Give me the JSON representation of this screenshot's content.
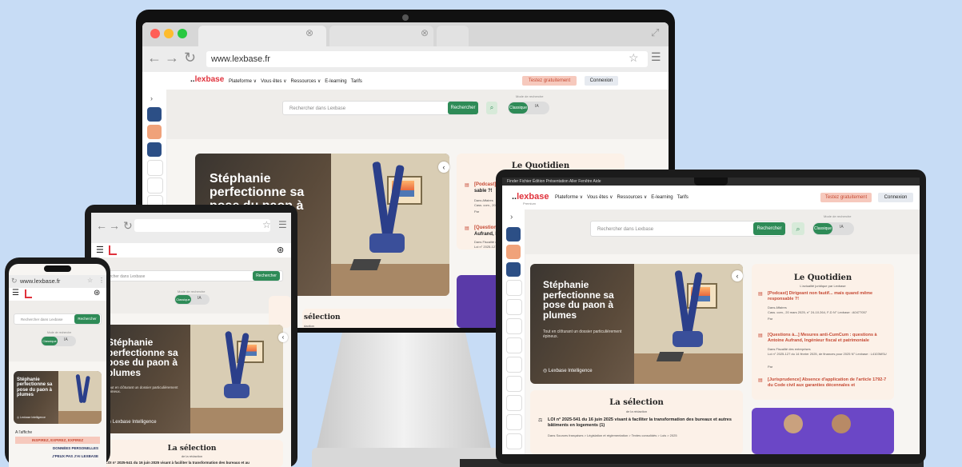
{
  "url": "www.lexbase.fr",
  "logo": {
    "prefix": "..",
    "name": "lexbase",
    "tagline": "Premium"
  },
  "nav": [
    "Plateforme ∨",
    "Vous êtes ∨",
    "Ressources ∨",
    "E-learning",
    "Tarifs"
  ],
  "buttons": {
    "try": "Testez gratuitement",
    "login": "Connexion",
    "search": "Rechercher"
  },
  "search": {
    "placeholder": "Rechercher dans Lexbase",
    "mode_label": "Mode de recherche",
    "mode_on": "Classique",
    "mode_off": "IA"
  },
  "hero": {
    "title": "Stéphanie perfectionne sa pose du paon à plumes",
    "subtitle": "Tout en clôturant un dossier particulièrement épineux.",
    "brand": "Lexbase Intelligence"
  },
  "quotidien": {
    "title": "Le Quotidien",
    "subtitle": "L'actualité juridique par Lexbase",
    "items": [
      {
        "title": "[Podcast] Dirigeant non fautif... mais quand même responsable ?!",
        "meta1": "Dans Affaires",
        "meta2": "Cass. com., 20 mars 2025, n° 24-10.264, F-D N° Lexbase : A0477057",
        "author": "Par"
      },
      {
        "title": "[Questions à...] Mesures anti-CumCum : questions à Antoine Aufrand, Ingénieur fiscal et patrimoniale",
        "meta1": "Dans Fiscalité des entreprises",
        "meta2": "Loi n° 2025-127 du 14 février 2025, de finances pour 2025 N° Lexbase : L4103MSU",
        "author": "Par"
      },
      {
        "title": "[Jurisprudence] Absence d'application de l'article 1792-7 du Code civil aux garanties décennales et"
      }
    ],
    "short_title_1": "[Podcast] Di",
    "short_title_1b": "sable ?!",
    "short_meta_1": "Dans Affaires",
    "short_meta_1b": "Cass. com., 20 m",
    "short_title_2": "[Questions",
    "short_title_2b": "Aufrand, Ing",
    "short_meta_2": "Dans Fiscalité d",
    "short_meta_2b": "Loi n° 2025-127"
  },
  "selection": {
    "title": "La sélection",
    "subtitle": "de la rédaction",
    "short_title": "sélection",
    "short_sub": "daction",
    "item": "LOI n° 2025-541 du 16 juin 2025 visant à faciliter la transformation des bureaux et autres bâtiments en logements (1)",
    "item_short": "LOI n° 2025-541 du 16 juin 2025 visant à faciliter la transformation des bureaux et au",
    "breadcrumb": "Dans Sources françaises > Législation et réglementation > Textes consolidés > Lois > 2025"
  },
  "phone": {
    "affiche_label": "A l'affiche",
    "cta": "INSPIREZ, EXPIREZ, EXPIREZ",
    "links": [
      "DONNÉES PERSONELLES",
      "J'PEUX PAS J'AI LEXBASE"
    ],
    "hero_title": "Stéphanie perfectionne sa pose du paon à plumes"
  },
  "macbar": "Finder  Fichier  Édition  Présentation  Aller  Fenêtre  Aide",
  "colors": {
    "green": "#2e8b57",
    "red": "#e0323c",
    "cream": "#fcf1e8",
    "bg": "#c7dcf5"
  },
  "icons": [
    "chevron-right-icon",
    "target-icon",
    "crop-icon",
    "pen-icon",
    "book-icon",
    "news-icon",
    "star-icon"
  ]
}
